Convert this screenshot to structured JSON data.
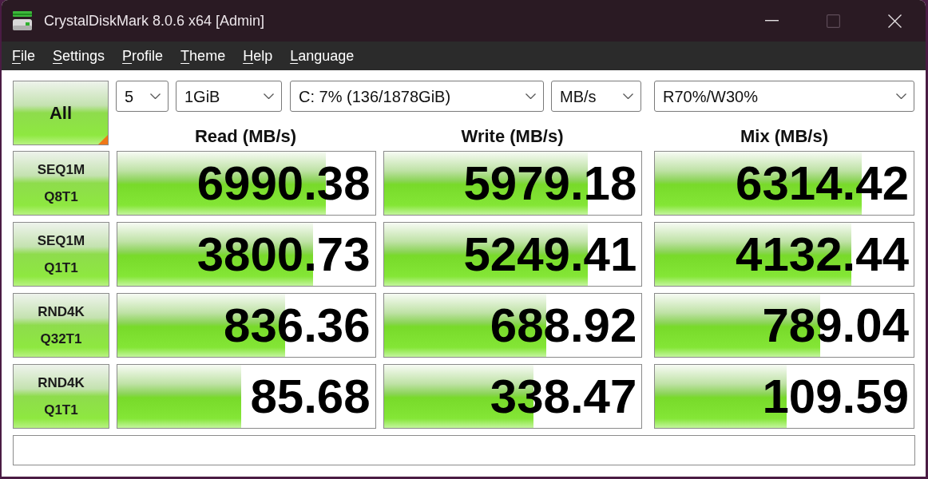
{
  "window": {
    "title": "CrystalDiskMark 8.0.6 x64 [Admin]",
    "controls": [
      {
        "kind": "minimize",
        "disabled": false
      },
      {
        "kind": "maximize",
        "disabled": true
      },
      {
        "kind": "close",
        "disabled": false
      }
    ]
  },
  "menu": [
    {
      "label": "File"
    },
    {
      "label": "Settings"
    },
    {
      "label": "Profile"
    },
    {
      "label": "Theme"
    },
    {
      "label": "Help"
    },
    {
      "label": "Language"
    }
  ],
  "toolbar": {
    "run_all_button": "All",
    "selects": [
      {
        "value": "5"
      },
      {
        "value": "1GiB"
      },
      {
        "value": "C: 7% (136/1878GiB)"
      },
      {
        "value": "MB/s"
      },
      {
        "value": "R70%/W30%"
      }
    ]
  },
  "columns": [
    "Read (MB/s)",
    "Write (MB/s)",
    "Mix (MB/s)"
  ],
  "rows": [
    {
      "test": "SEQ1M",
      "params": "Q8T1",
      "results": [
        {
          "value": "6990.38",
          "level": 0.81
        },
        {
          "value": "5979.18",
          "level": 0.79
        },
        {
          "value": "6314.42",
          "level": 0.8
        }
      ]
    },
    {
      "test": "SEQ1M",
      "params": "Q1T1",
      "results": [
        {
          "value": "3800.73",
          "level": 0.76
        },
        {
          "value": "5249.41",
          "level": 0.79
        },
        {
          "value": "4132.44",
          "level": 0.76
        }
      ]
    },
    {
      "test": "RND4K",
      "params": "Q32T1",
      "results": [
        {
          "value": "836.36",
          "level": 0.65
        },
        {
          "value": "688.92",
          "level": 0.63
        },
        {
          "value": "789.04",
          "level": 0.64
        }
      ]
    },
    {
      "test": "RND4K",
      "params": "Q1T1",
      "results": [
        {
          "value": "85.68",
          "level": 0.48
        },
        {
          "value": "338.47",
          "level": 0.58
        },
        {
          "value": "109.59",
          "level": 0.51
        }
      ]
    }
  ]
}
